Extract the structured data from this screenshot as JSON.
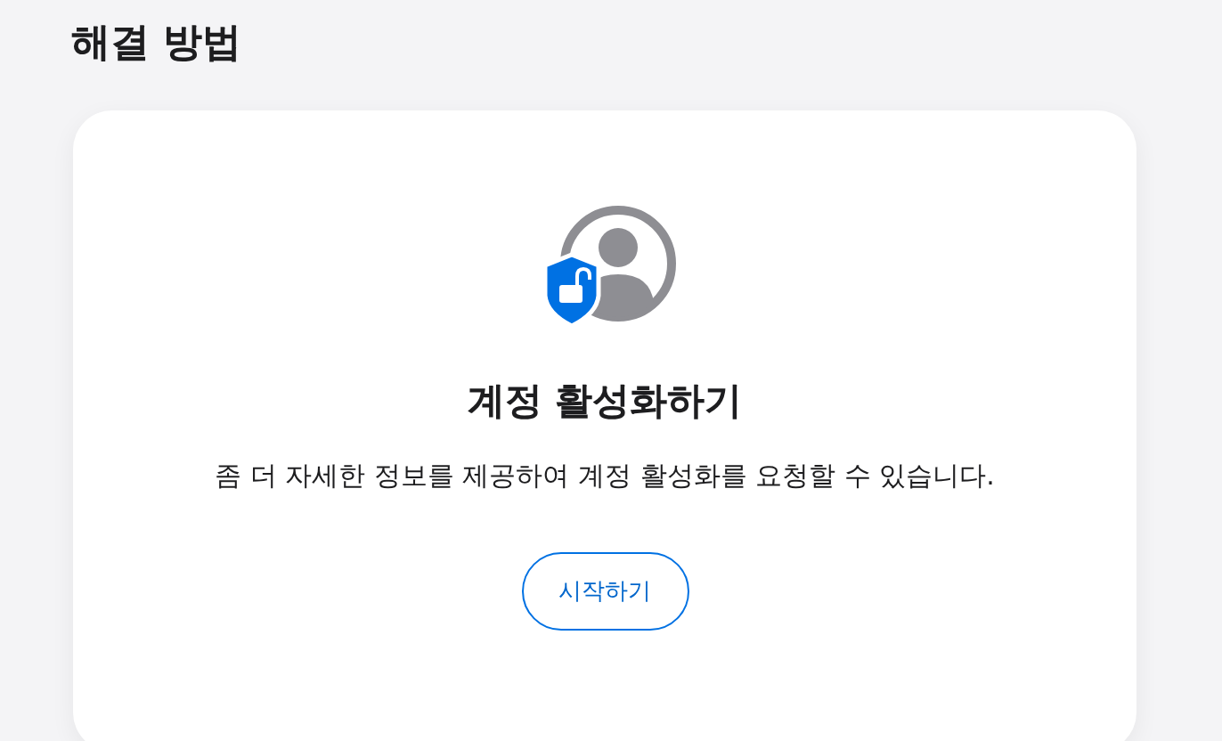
{
  "heading": "해결 방법",
  "card": {
    "title": "계정 활성화하기",
    "description": "좀 더 자세한 정보를 제공하여 계정 활성화를 요청할 수 있습니다.",
    "button": "시작하기"
  }
}
